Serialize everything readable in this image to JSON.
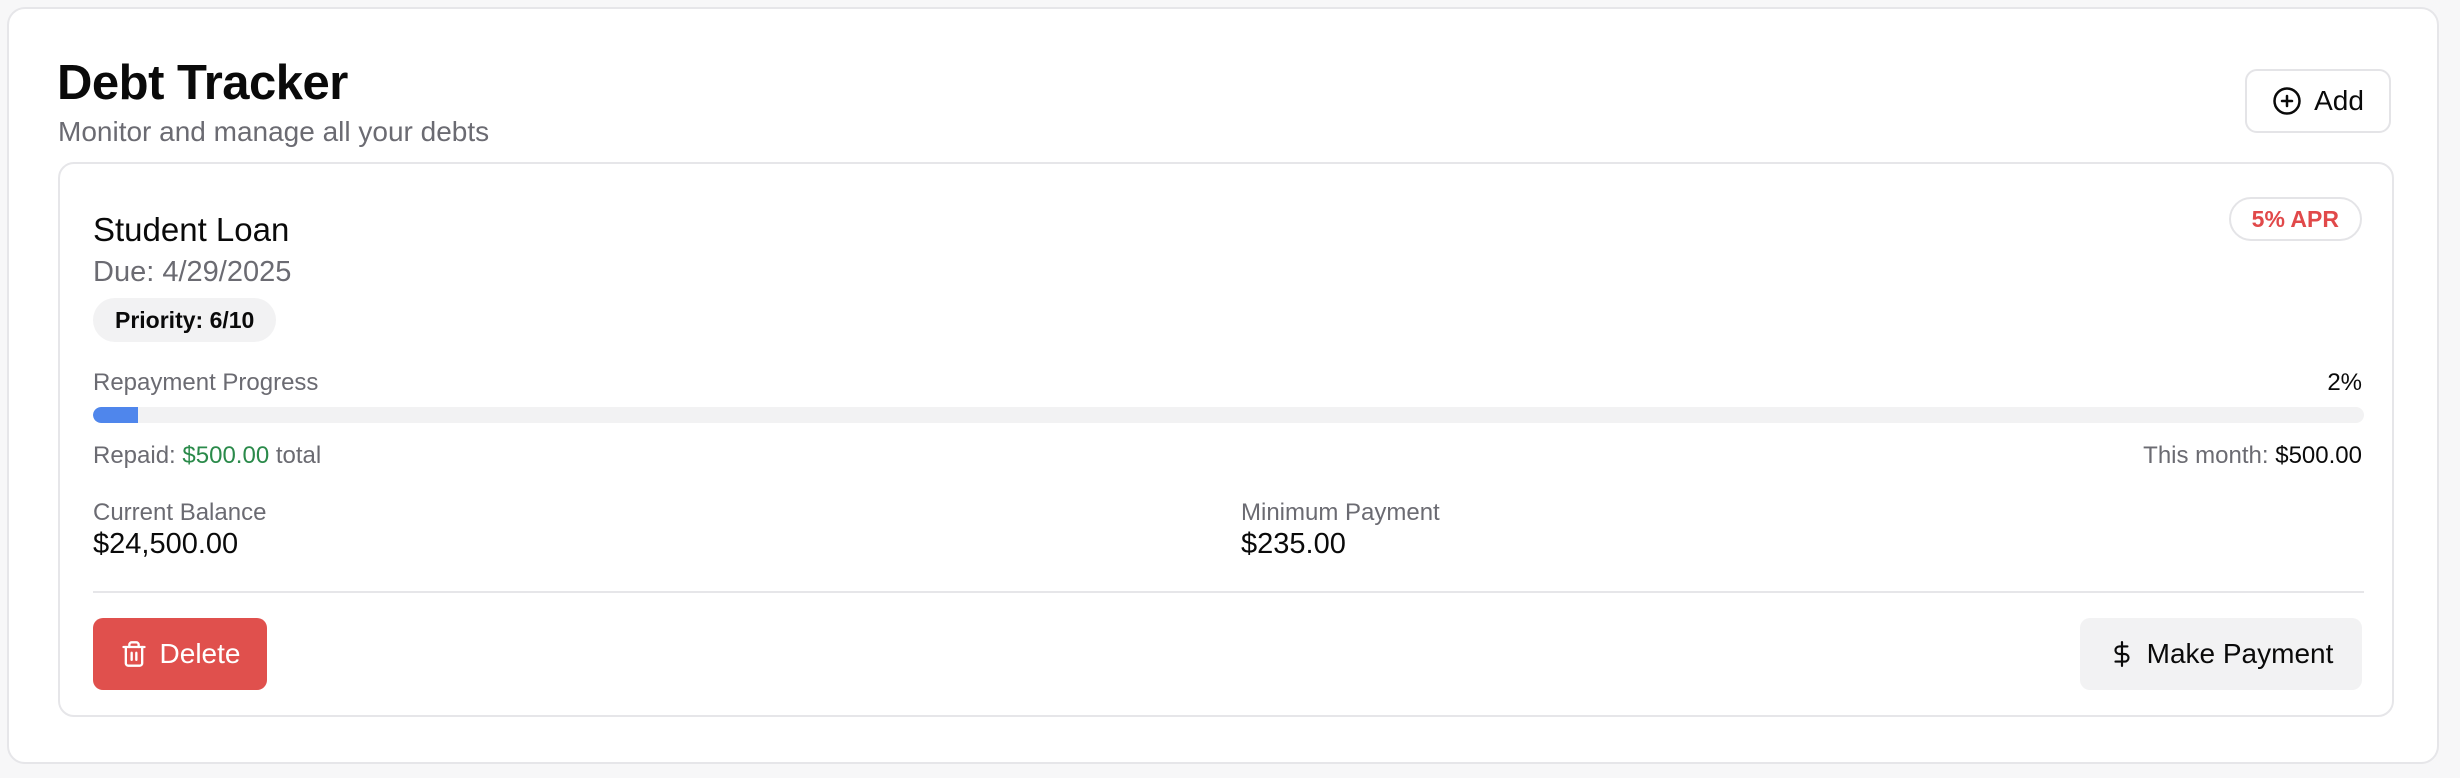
{
  "header": {
    "title": "Debt Tracker",
    "subtitle": "Monitor and manage all your debts",
    "add_label": "Add"
  },
  "debt": {
    "name": "Student Loan",
    "due": "Due: 4/29/2025",
    "priority": "Priority: 6/10",
    "apr": "5% APR",
    "progress_label": "Repayment Progress",
    "progress_percent": "2%",
    "progress_fraction": 0.02,
    "repaid_prefix": "Repaid:",
    "repaid_amount": "$500.00",
    "repaid_suffix": "total",
    "this_month_label": "This month:",
    "this_month_amount": "$500.00",
    "current_balance_label": "Current Balance",
    "current_balance": "$24,500.00",
    "minimum_payment_label": "Minimum Payment",
    "minimum_payment": "$235.00",
    "delete_label": "Delete",
    "make_payment_label": "Make Payment"
  },
  "colors": {
    "accent_blue": "#4f86ec",
    "delete_red": "#e0504d",
    "apr_red": "#e1494a",
    "repaid_green": "#2a8a4a"
  },
  "icons": {
    "add": "plus-circle-icon",
    "delete": "trash-icon",
    "payment": "dollar-sign-icon"
  }
}
